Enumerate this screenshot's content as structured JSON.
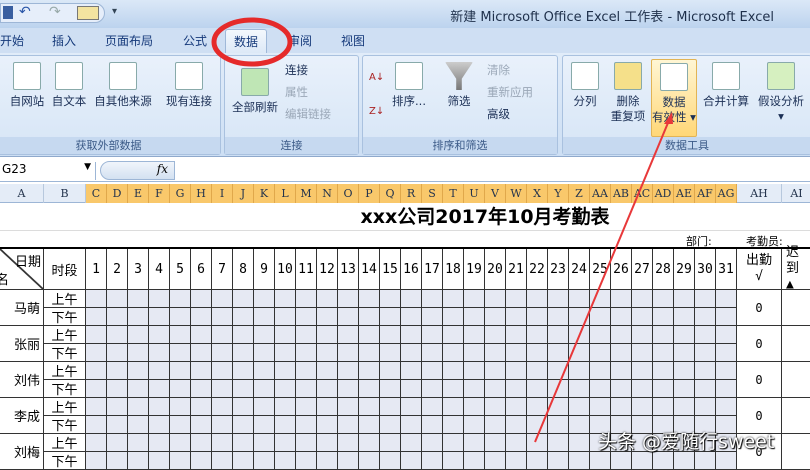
{
  "window": {
    "title": "新建 Microsoft Office Excel 工作表 - Microsoft Excel"
  },
  "tabs": [
    "开始",
    "插入",
    "页面布局",
    "公式",
    "数据",
    "审阅",
    "视图"
  ],
  "active_tab": "数据",
  "ribbon": {
    "get_external": {
      "label": "获取外部数据",
      "buttons": [
        "自网站",
        "自文本",
        "自其他来源",
        "现有连接"
      ]
    },
    "connections": {
      "label": "连接",
      "refresh": "全部刷新",
      "items": [
        "连接",
        "属性",
        "编辑链接"
      ]
    },
    "sort_filter": {
      "label": "排序和筛选",
      "sort": "排序...",
      "filter": "筛选",
      "items": [
        "清除",
        "重新应用",
        "高级"
      ]
    },
    "data_tools": {
      "label": "数据工具",
      "split": "分列",
      "dedupe_1": "删除",
      "dedupe_2": "重复项",
      "validation_1": "数据",
      "validation_2": "有效性",
      "consolidate": "合并计算",
      "whatif": "假设分析"
    }
  },
  "formula_bar": {
    "name_box": "G23",
    "fx": "fx",
    "value": ""
  },
  "columns": [
    "A",
    "B",
    "C",
    "D",
    "E",
    "F",
    "G",
    "H",
    "I",
    "J",
    "K",
    "L",
    "M",
    "N",
    "O",
    "P",
    "Q",
    "R",
    "S",
    "T",
    "U",
    "V",
    "W",
    "X",
    "Y",
    "Z",
    "AA",
    "AB",
    "AC",
    "AD",
    "AE",
    "AF",
    "AG",
    "AH",
    "AI"
  ],
  "sheet": {
    "title": "xxx公司2017年10月考勤表",
    "dept_label": "部门:",
    "clerk_label": "考勤员:",
    "header_date": "日期",
    "header_name": "名",
    "header_period": "时段",
    "days": [
      "1",
      "2",
      "3",
      "4",
      "5",
      "6",
      "7",
      "8",
      "9",
      "10",
      "11",
      "12",
      "13",
      "14",
      "15",
      "16",
      "17",
      "18",
      "19",
      "20",
      "21",
      "22",
      "23",
      "24",
      "25",
      "26",
      "27",
      "28",
      "29",
      "30",
      "31"
    ],
    "attend_label": "出勤",
    "attend_mark": "√",
    "late_label": "迟到",
    "late_mark": "▲",
    "am": "上午",
    "pm": "下午",
    "employees": [
      {
        "name": "马萌",
        "attend": "0"
      },
      {
        "name": "张丽",
        "attend": "0"
      },
      {
        "name": "刘伟",
        "attend": "0"
      },
      {
        "name": "李成",
        "attend": "0"
      },
      {
        "name": "刘梅",
        "attend": "0"
      }
    ]
  },
  "watermark": "头条 @爱随行sweet"
}
